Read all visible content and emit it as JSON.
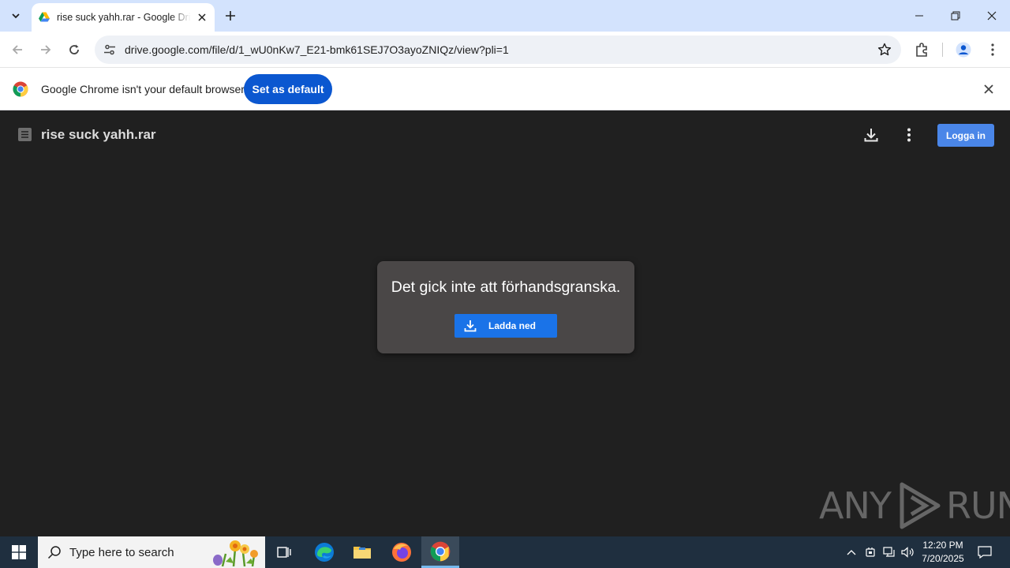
{
  "browser": {
    "tab_title": "rise suck yahh.rar - Google Drive",
    "url": "drive.google.com/file/d/1_wU0nKw7_E21-bmk61SEJ7O3ayoZNIQz/view?pli=1"
  },
  "infobar": {
    "message": "Google Chrome isn't your default browser",
    "button_label": "Set as default"
  },
  "viewer": {
    "file_name": "rise suck yahh.rar",
    "login_label": "Logga in",
    "error_message": "Det gick inte att förhandsgranska.",
    "download_label": "Ladda ned"
  },
  "watermark": {
    "left": "ANY",
    "right": "RUN"
  },
  "taskbar": {
    "search_placeholder": "Type here to search",
    "time": "12:20 PM",
    "date": "7/20/2025"
  },
  "colors": {
    "tabstrip": "#d3e3fd",
    "infobar_button": "#0b57d0",
    "viewer_bg": "#202020",
    "dialog_bg": "#4a4747",
    "download_button": "#1a73e8",
    "login_button": "#4a86e8"
  }
}
